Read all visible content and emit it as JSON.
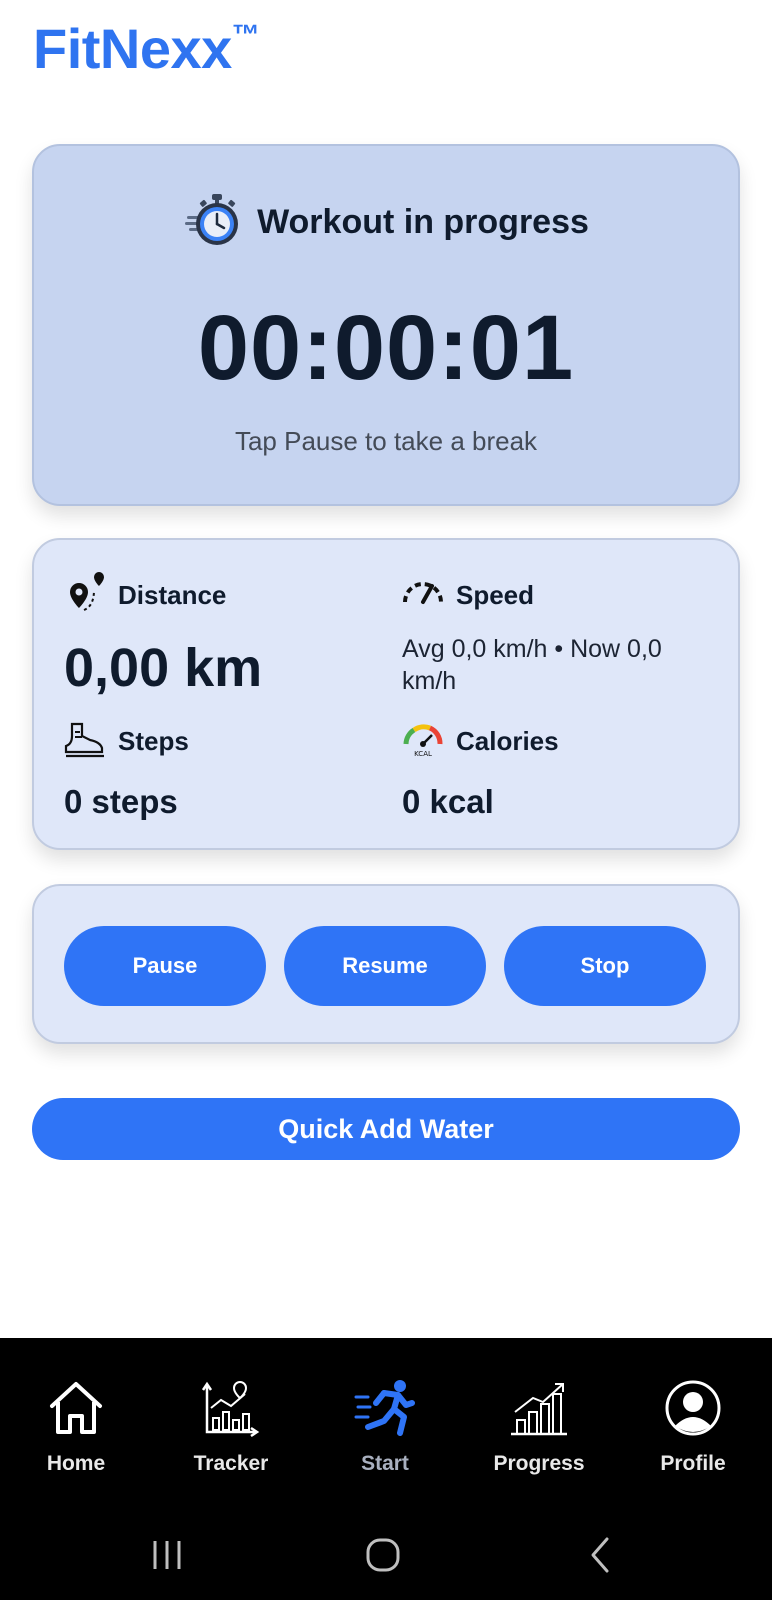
{
  "brand": {
    "name": "FitNexx",
    "mark": "™"
  },
  "timer_card": {
    "icon": "stopwatch-icon",
    "title": "Workout in progress",
    "elapsed": "00:00:01",
    "hint": "Tap Pause to take a break"
  },
  "stats": {
    "distance": {
      "icon": "map-pin-route-icon",
      "label": "Distance",
      "value": "0,00 km"
    },
    "speed": {
      "icon": "speedometer-icon",
      "label": "Speed",
      "value": "Avg 0,0 km/h • Now 0,0 km/h"
    },
    "steps": {
      "icon": "shoe-icon",
      "label": "Steps",
      "value": "0 steps"
    },
    "calories": {
      "icon": "kcal-gauge-icon",
      "label": "Calories",
      "value": "0 kcal"
    }
  },
  "controls": {
    "pause": "Pause",
    "resume": "Resume",
    "stop": "Stop"
  },
  "water_button": "Quick Add Water",
  "nav": [
    {
      "label": "Home",
      "icon": "home-icon",
      "active": false
    },
    {
      "label": "Tracker",
      "icon": "tracker-chart-icon",
      "active": false
    },
    {
      "label": "Start",
      "icon": "runner-icon",
      "active": true
    },
    {
      "label": "Progress",
      "icon": "progress-bars-icon",
      "active": false
    },
    {
      "label": "Profile",
      "icon": "profile-icon",
      "active": false
    }
  ],
  "colors": {
    "brand": "#2f74f0",
    "button": "#2f74f6",
    "timer_card": "#c6d4f0",
    "stats_card": "#dfe7f9",
    "active_nav_icon": "#2f74f6"
  }
}
